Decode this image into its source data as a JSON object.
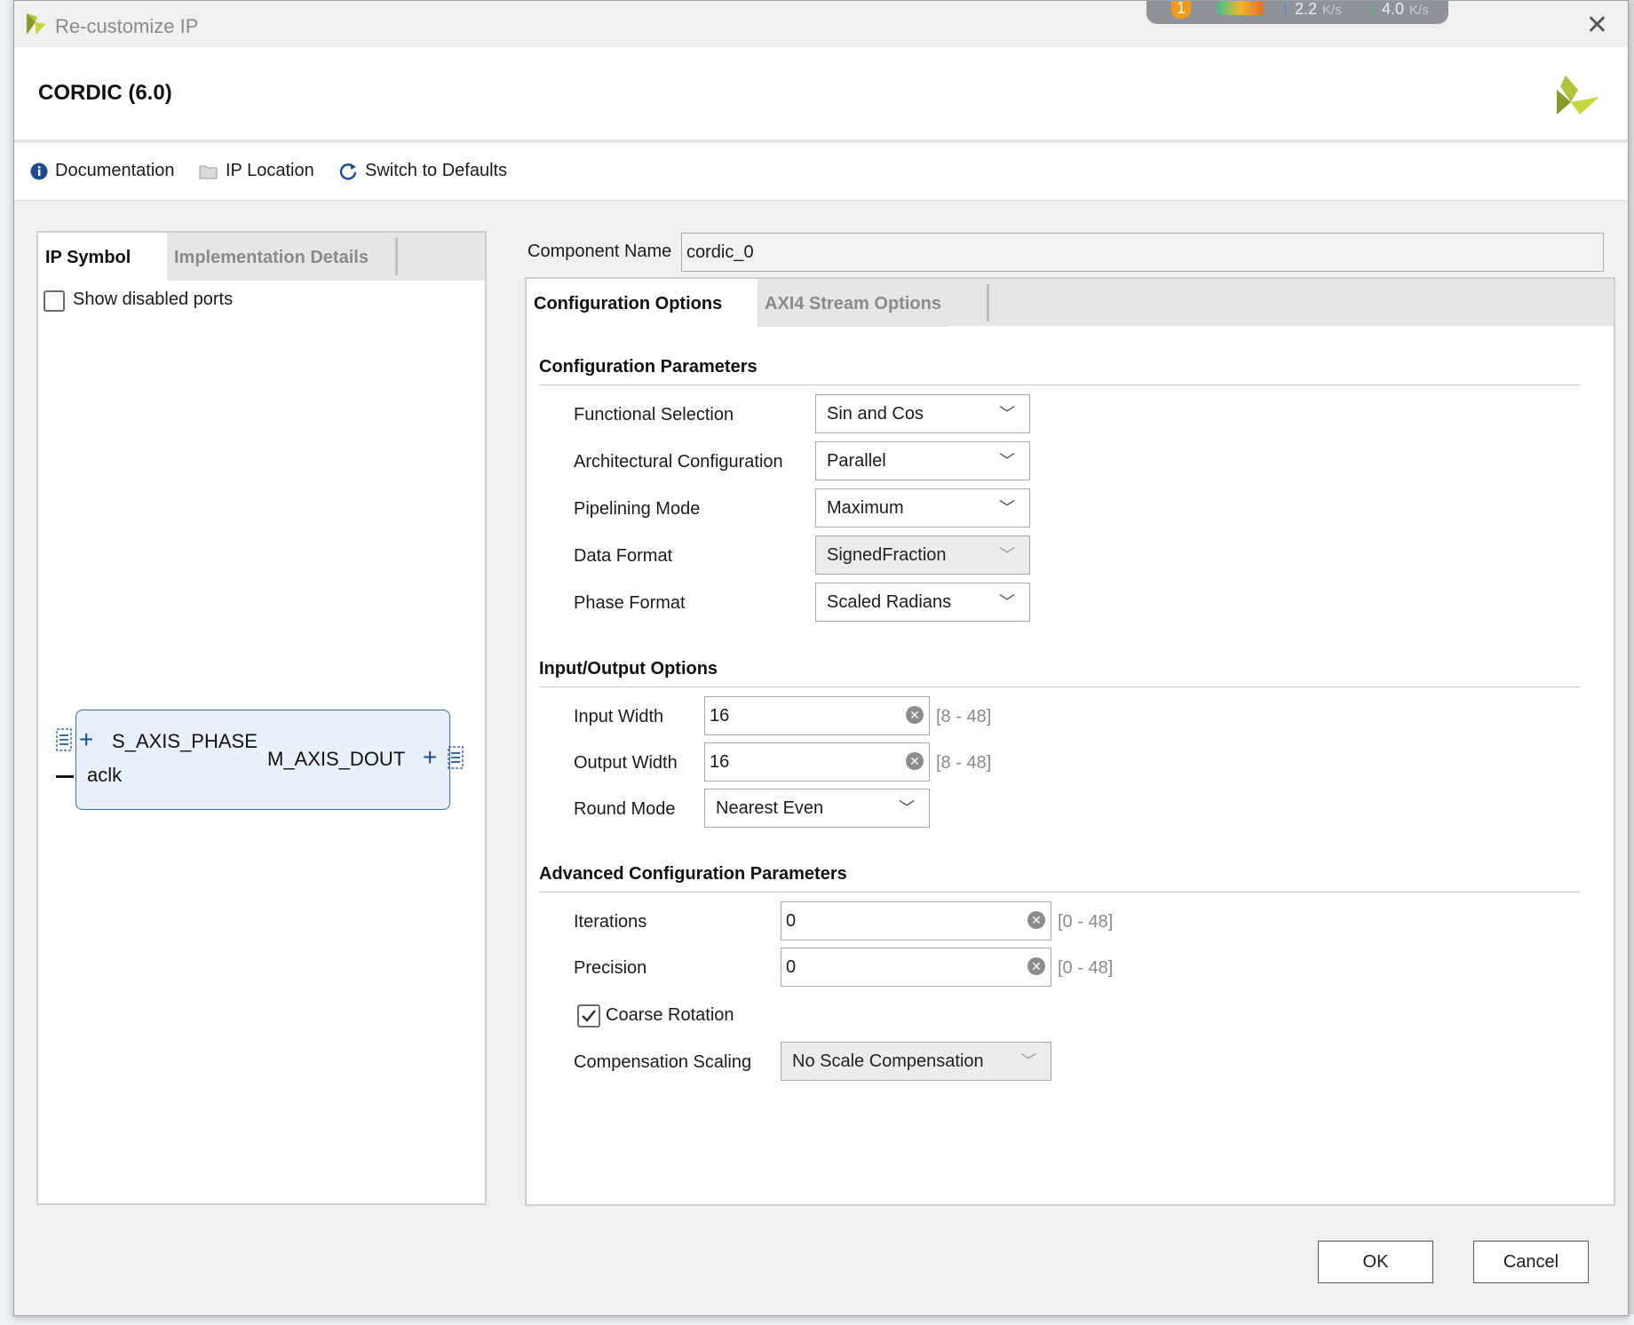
{
  "window": {
    "title": "Re-customize IP",
    "close_glyph": "✕"
  },
  "netmon": {
    "badge": "1",
    "up_rate": "2.2",
    "down_rate": "4.0",
    "unit": "K/s"
  },
  "header": {
    "title": "CORDIC (6.0)"
  },
  "toolbar": {
    "documentation": "Documentation",
    "ip_location": "IP Location",
    "switch_defaults": "Switch to Defaults"
  },
  "left": {
    "tabs": [
      "IP Symbol",
      "Implementation Details"
    ],
    "show_disabled_ports": "Show disabled ports",
    "symbol": {
      "pin_s_axis_phase": "S_AXIS_PHASE",
      "pin_aclk": "aclk",
      "pin_m_axis_dout": "M_AXIS_DOUT"
    }
  },
  "component": {
    "label": "Component Name",
    "value": "cordic_0"
  },
  "right": {
    "tabs": [
      "Configuration Options",
      "AXI4 Stream Options"
    ],
    "config_params": {
      "heading": "Configuration Parameters",
      "functional_selection": {
        "label": "Functional Selection",
        "value": "Sin and Cos"
      },
      "arch_config": {
        "label": "Architectural Configuration",
        "value": "Parallel"
      },
      "pipelining": {
        "label": "Pipelining Mode",
        "value": "Maximum"
      },
      "data_format": {
        "label": "Data Format",
        "value": "SignedFraction"
      },
      "phase_format": {
        "label": "Phase Format",
        "value": "Scaled Radians"
      }
    },
    "io_options": {
      "heading": "Input/Output Options",
      "input_width": {
        "label": "Input Width",
        "value": "16",
        "range": "[8 - 48]"
      },
      "output_width": {
        "label": "Output Width",
        "value": "16",
        "range": "[8 - 48]"
      },
      "round_mode": {
        "label": "Round Mode",
        "value": "Nearest Even"
      }
    },
    "advanced": {
      "heading": "Advanced Configuration Parameters",
      "iterations": {
        "label": "Iterations",
        "value": "0",
        "range": "[0 - 48]"
      },
      "precision": {
        "label": "Precision",
        "value": "0",
        "range": "[0 - 48]"
      },
      "coarse_rotation": {
        "label": "Coarse Rotation",
        "checked": true
      },
      "compensation": {
        "label": "Compensation Scaling",
        "value": "No Scale Compensation"
      }
    }
  },
  "buttons": {
    "ok": "OK",
    "cancel": "Cancel"
  }
}
